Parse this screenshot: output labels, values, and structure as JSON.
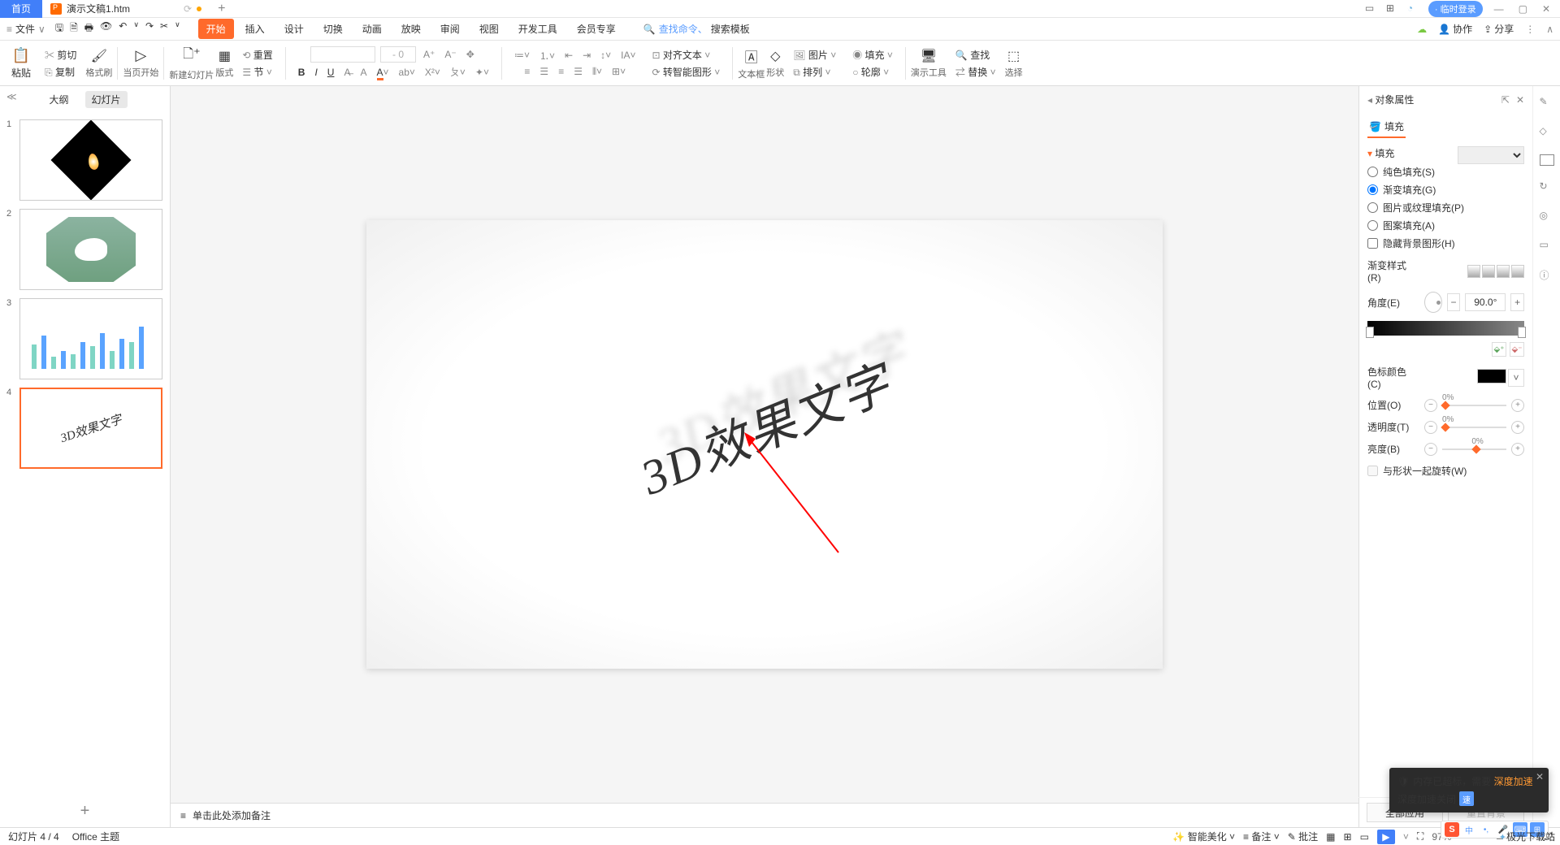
{
  "titlebar": {
    "home": "首页",
    "doc_name": "演示文稿1.htm",
    "login": "· 临时登录"
  },
  "menubar": {
    "file": "文件",
    "search_link": "查找命令、",
    "search_placeholder": "搜索模板",
    "collab": "协作",
    "share": "分享"
  },
  "ribbon": {
    "tabs": [
      "开始",
      "插入",
      "设计",
      "切换",
      "动画",
      "放映",
      "审阅",
      "视图",
      "开发工具",
      "会员专享"
    ]
  },
  "toolbar": {
    "paste": "粘贴",
    "cut": "剪切",
    "copy": "复制",
    "fmt": "格式刷",
    "from_current": "当页开始",
    "new_slide": "新建幻灯片",
    "layout": "版式",
    "section": "节",
    "reset": "重置",
    "align_text": "对齐文本",
    "smart_shape": "转智能图形",
    "textbox": "文本框",
    "shape": "形状",
    "picture": "图片",
    "arrange": "排列",
    "fill": "填充",
    "outline": "轮廓",
    "tools": "演示工具",
    "find": "查找",
    "replace": "替换",
    "select": "选择"
  },
  "slide_panel": {
    "tab_outline": "大纲",
    "tab_slides": "幻灯片"
  },
  "canvas": {
    "text": "3D效果文字",
    "notes_placeholder": "单击此处添加备注"
  },
  "prop": {
    "title": "对象属性",
    "tab_fill": "填充",
    "section_fill": "填充",
    "r_solid": "纯色填充(S)",
    "r_gradient": "渐变填充(G)",
    "r_picture": "图片或纹理填充(P)",
    "r_pattern": "图案填充(A)",
    "c_hide": "隐藏背景图形(H)",
    "grad_style": "渐变样式(R)",
    "angle": "角度(E)",
    "angle_val": "90.0°",
    "stop_color": "色标颜色(C)",
    "position": "位置(O)",
    "pos_val": "0%",
    "transparency": "透明度(T)",
    "trans_val": "0%",
    "brightness": "亮度(B)",
    "bright_val": "0%",
    "rotate_with": "与形状一起旋转(W)",
    "apply_all": "全部应用",
    "reset_bg": "重置背景"
  },
  "status": {
    "slide_no": "幻灯片 4 / 4",
    "theme": "Office 主题",
    "beautify": "智能美化",
    "notes": "备注",
    "comments": "批注",
    "zoom": "97%"
  },
  "popup": {
    "line1a": "内存已超标，需要 ",
    "line1b": "深度加速",
    "line2": "深度加速关闭",
    "suffix": "速"
  },
  "ime": {
    "zh": "中"
  },
  "watermark": "极光下载站"
}
